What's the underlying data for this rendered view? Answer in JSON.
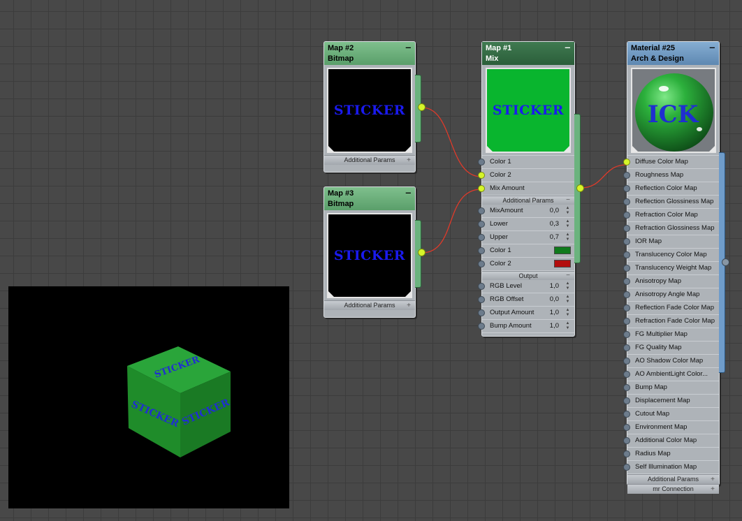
{
  "nodes": {
    "map2": {
      "title": "Map #2",
      "type": "Bitmap",
      "preview_text": "STICKER",
      "params_label": "Additional Params",
      "preview_bg": "#000000"
    },
    "map3": {
      "title": "Map #3",
      "type": "Bitmap",
      "preview_text": "STICKER",
      "params_label": "Additional Params",
      "preview_bg": "#000000"
    },
    "map1": {
      "title": "Map #1",
      "type": "Mix",
      "preview_text": "STICKER",
      "preview_bg": "#09b52e",
      "inputs": [
        {
          "label": "Color 1",
          "connected": false
        },
        {
          "label": "Color 2",
          "connected": true
        },
        {
          "label": "Mix Amount",
          "connected": true
        }
      ],
      "additional_params_label": "Additional Params",
      "params": [
        {
          "label": "MixAmount",
          "value": "0,0"
        },
        {
          "label": "Lower",
          "value": "0,3"
        },
        {
          "label": "Upper",
          "value": "0,7"
        }
      ],
      "colors": [
        {
          "label": "Color 1",
          "swatch": "#0f7a1c"
        },
        {
          "label": "Color 2",
          "swatch": "#b30d0d"
        }
      ],
      "output_label": "Output",
      "output_params": [
        {
          "label": "RGB Level",
          "value": "1,0"
        },
        {
          "label": "RGB Offset",
          "value": "0,0"
        },
        {
          "label": "Output Amount",
          "value": "1,0"
        },
        {
          "label": "Bump Amount",
          "value": "1,0"
        }
      ]
    },
    "material25": {
      "title": "Material #25",
      "type": "Arch & Design",
      "preview_text": "ICK",
      "slots": [
        "Diffuse Color Map",
        "Roughness Map",
        "Reflection Color Map",
        "Reflection Glossiness Map",
        "Refraction Color Map",
        "Refraction Glossiness Map",
        "IOR Map",
        "Translucency Color Map",
        "Translucency Weight Map",
        "Anisotropy Map",
        "Anisotropy Angle Map",
        "Reflection Fade Color Map",
        "Refraction Fade Color Map",
        "FG Multiplier Map",
        "FG Quality Map",
        "AO Shadow Color Map",
        "AO AmbientLight Color...",
        "Bump Map",
        "Displacement Map",
        "Cutout Map",
        "Environment Map",
        "Additional Color Map",
        "Radius Map",
        "Self Illumination Map"
      ],
      "footer": [
        "Additional Params",
        "mr Connection"
      ]
    }
  },
  "viewport": {
    "face_text": "STICKER",
    "cube_color": "#1f8c2a"
  },
  "colors": {
    "wire": "#e03a2a",
    "socket_on": "#d6f52a",
    "node_bg": "#aeb3b8"
  }
}
